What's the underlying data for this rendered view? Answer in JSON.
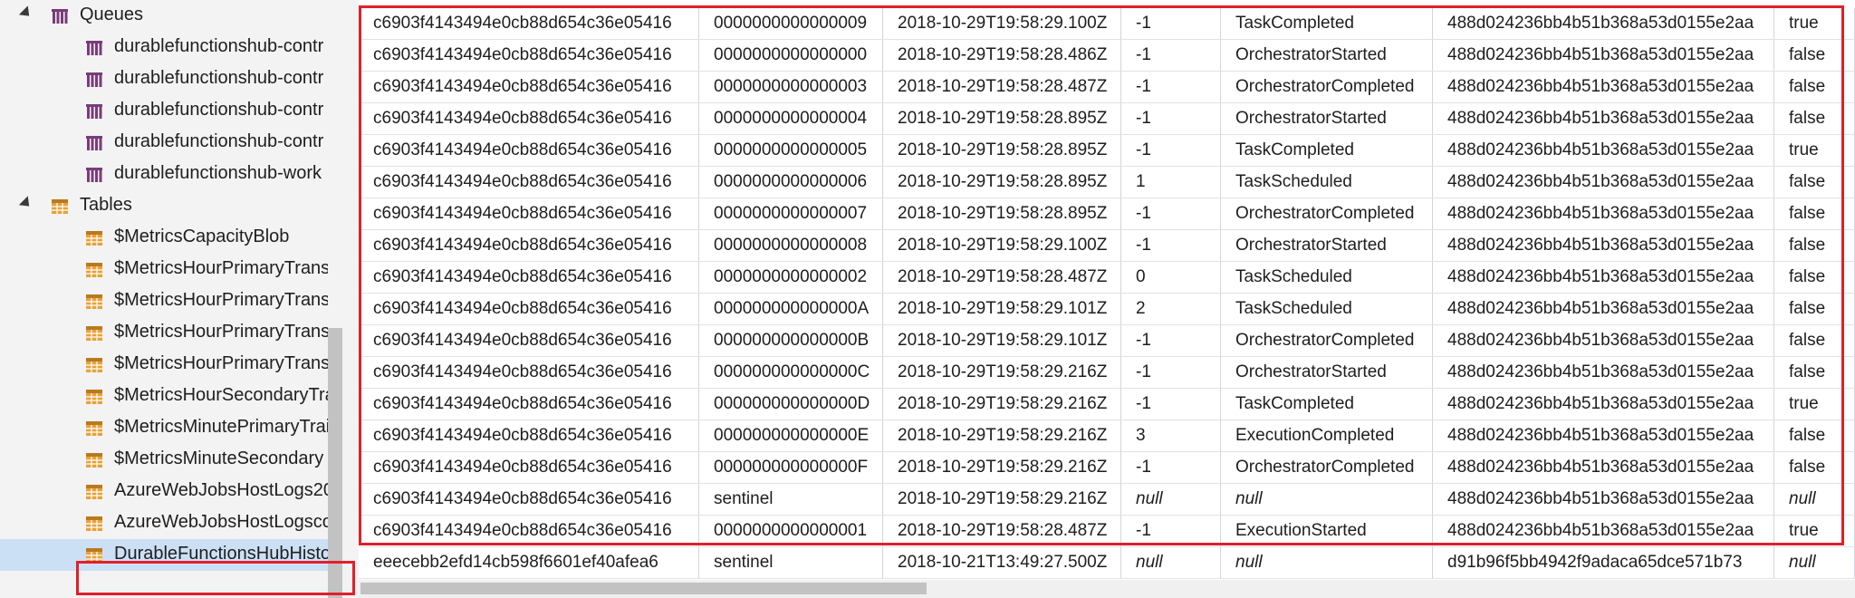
{
  "tree": {
    "queues_label": "Queues",
    "queues": [
      "durablefunctionshub-contr",
      "durablefunctionshub-contr",
      "durablefunctionshub-contr",
      "durablefunctionshub-contr",
      "durablefunctionshub-work"
    ],
    "tables_label": "Tables",
    "tables": [
      "$MetricsCapacityBlob",
      "$MetricsHourPrimaryTrans",
      "$MetricsHourPrimaryTrans",
      "$MetricsHourPrimaryTrans",
      "$MetricsHourPrimaryTrans",
      "$MetricsHourSecondaryTra",
      "$MetricsMinutePrimaryTrai",
      "$MetricsMinuteSecondary",
      "AzureWebJobsHostLogs20",
      "AzureWebJobsHostLogsco",
      "DurableFunctionsHubHisto"
    ],
    "selected_table_index": 10,
    "colors": {
      "queue_icon": "#7a3b7a",
      "table_icon": "#e8a23a",
      "selection": "#cce0f5",
      "highlight": "#e0202a"
    }
  },
  "grid": {
    "rows": [
      [
        "c6903f4143494e0cb88d654c36e05416",
        "0000000000000009",
        "2018-10-29T19:58:29.100Z",
        "-1",
        "TaskCompleted",
        "488d024236bb4b51b368a53d0155e2aa",
        "true"
      ],
      [
        "c6903f4143494e0cb88d654c36e05416",
        "0000000000000000",
        "2018-10-29T19:58:28.486Z",
        "-1",
        "OrchestratorStarted",
        "488d024236bb4b51b368a53d0155e2aa",
        "false"
      ],
      [
        "c6903f4143494e0cb88d654c36e05416",
        "0000000000000003",
        "2018-10-29T19:58:28.487Z",
        "-1",
        "OrchestratorCompleted",
        "488d024236bb4b51b368a53d0155e2aa",
        "false"
      ],
      [
        "c6903f4143494e0cb88d654c36e05416",
        "0000000000000004",
        "2018-10-29T19:58:28.895Z",
        "-1",
        "OrchestratorStarted",
        "488d024236bb4b51b368a53d0155e2aa",
        "false"
      ],
      [
        "c6903f4143494e0cb88d654c36e05416",
        "0000000000000005",
        "2018-10-29T19:58:28.895Z",
        "-1",
        "TaskCompleted",
        "488d024236bb4b51b368a53d0155e2aa",
        "true"
      ],
      [
        "c6903f4143494e0cb88d654c36e05416",
        "0000000000000006",
        "2018-10-29T19:58:28.895Z",
        "1",
        "TaskScheduled",
        "488d024236bb4b51b368a53d0155e2aa",
        "false"
      ],
      [
        "c6903f4143494e0cb88d654c36e05416",
        "0000000000000007",
        "2018-10-29T19:58:28.895Z",
        "-1",
        "OrchestratorCompleted",
        "488d024236bb4b51b368a53d0155e2aa",
        "false"
      ],
      [
        "c6903f4143494e0cb88d654c36e05416",
        "0000000000000008",
        "2018-10-29T19:58:29.100Z",
        "-1",
        "OrchestratorStarted",
        "488d024236bb4b51b368a53d0155e2aa",
        "false"
      ],
      [
        "c6903f4143494e0cb88d654c36e05416",
        "0000000000000002",
        "2018-10-29T19:58:28.487Z",
        "0",
        "TaskScheduled",
        "488d024236bb4b51b368a53d0155e2aa",
        "false"
      ],
      [
        "c6903f4143494e0cb88d654c36e05416",
        "000000000000000A",
        "2018-10-29T19:58:29.101Z",
        "2",
        "TaskScheduled",
        "488d024236bb4b51b368a53d0155e2aa",
        "false"
      ],
      [
        "c6903f4143494e0cb88d654c36e05416",
        "000000000000000B",
        "2018-10-29T19:58:29.101Z",
        "-1",
        "OrchestratorCompleted",
        "488d024236bb4b51b368a53d0155e2aa",
        "false"
      ],
      [
        "c6903f4143494e0cb88d654c36e05416",
        "000000000000000C",
        "2018-10-29T19:58:29.216Z",
        "-1",
        "OrchestratorStarted",
        "488d024236bb4b51b368a53d0155e2aa",
        "false"
      ],
      [
        "c6903f4143494e0cb88d654c36e05416",
        "000000000000000D",
        "2018-10-29T19:58:29.216Z",
        "-1",
        "TaskCompleted",
        "488d024236bb4b51b368a53d0155e2aa",
        "true"
      ],
      [
        "c6903f4143494e0cb88d654c36e05416",
        "000000000000000E",
        "2018-10-29T19:58:29.216Z",
        "3",
        "ExecutionCompleted",
        "488d024236bb4b51b368a53d0155e2aa",
        "false"
      ],
      [
        "c6903f4143494e0cb88d654c36e05416",
        "000000000000000F",
        "2018-10-29T19:58:29.216Z",
        "-1",
        "OrchestratorCompleted",
        "488d024236bb4b51b368a53d0155e2aa",
        "false"
      ],
      [
        "c6903f4143494e0cb88d654c36e05416",
        "sentinel",
        "2018-10-29T19:58:29.216Z",
        "null",
        "null",
        "488d024236bb4b51b368a53d0155e2aa",
        "null"
      ],
      [
        "c6903f4143494e0cb88d654c36e05416",
        "0000000000000001",
        "2018-10-29T19:58:28.487Z",
        "-1",
        "ExecutionStarted",
        "488d024236bb4b51b368a53d0155e2aa",
        "true"
      ],
      [
        "eeecebb2efd14cb598f6601ef40afea6",
        "sentinel",
        "2018-10-21T13:49:27.500Z",
        "null",
        "null",
        "d91b96f5bb4942f9adaca65dce571b73",
        "null"
      ]
    ]
  }
}
